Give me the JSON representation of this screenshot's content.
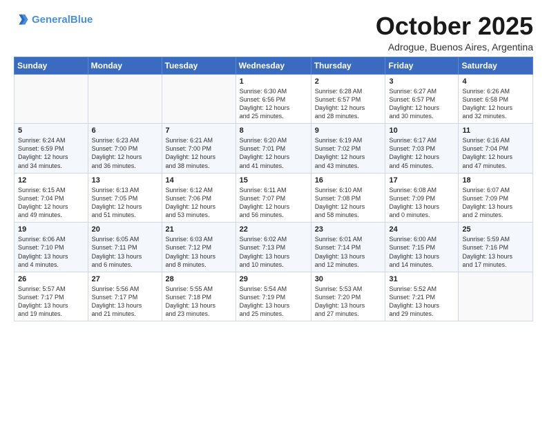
{
  "header": {
    "logo_line1": "General",
    "logo_line2": "Blue",
    "month": "October 2025",
    "location": "Adrogue, Buenos Aires, Argentina"
  },
  "weekdays": [
    "Sunday",
    "Monday",
    "Tuesday",
    "Wednesday",
    "Thursday",
    "Friday",
    "Saturday"
  ],
  "weeks": [
    [
      {
        "day": "",
        "content": ""
      },
      {
        "day": "",
        "content": ""
      },
      {
        "day": "",
        "content": ""
      },
      {
        "day": "1",
        "content": "Sunrise: 6:30 AM\nSunset: 6:56 PM\nDaylight: 12 hours\nand 25 minutes."
      },
      {
        "day": "2",
        "content": "Sunrise: 6:28 AM\nSunset: 6:57 PM\nDaylight: 12 hours\nand 28 minutes."
      },
      {
        "day": "3",
        "content": "Sunrise: 6:27 AM\nSunset: 6:57 PM\nDaylight: 12 hours\nand 30 minutes."
      },
      {
        "day": "4",
        "content": "Sunrise: 6:26 AM\nSunset: 6:58 PM\nDaylight: 12 hours\nand 32 minutes."
      }
    ],
    [
      {
        "day": "5",
        "content": "Sunrise: 6:24 AM\nSunset: 6:59 PM\nDaylight: 12 hours\nand 34 minutes."
      },
      {
        "day": "6",
        "content": "Sunrise: 6:23 AM\nSunset: 7:00 PM\nDaylight: 12 hours\nand 36 minutes."
      },
      {
        "day": "7",
        "content": "Sunrise: 6:21 AM\nSunset: 7:00 PM\nDaylight: 12 hours\nand 38 minutes."
      },
      {
        "day": "8",
        "content": "Sunrise: 6:20 AM\nSunset: 7:01 PM\nDaylight: 12 hours\nand 41 minutes."
      },
      {
        "day": "9",
        "content": "Sunrise: 6:19 AM\nSunset: 7:02 PM\nDaylight: 12 hours\nand 43 minutes."
      },
      {
        "day": "10",
        "content": "Sunrise: 6:17 AM\nSunset: 7:03 PM\nDaylight: 12 hours\nand 45 minutes."
      },
      {
        "day": "11",
        "content": "Sunrise: 6:16 AM\nSunset: 7:04 PM\nDaylight: 12 hours\nand 47 minutes."
      }
    ],
    [
      {
        "day": "12",
        "content": "Sunrise: 6:15 AM\nSunset: 7:04 PM\nDaylight: 12 hours\nand 49 minutes."
      },
      {
        "day": "13",
        "content": "Sunrise: 6:13 AM\nSunset: 7:05 PM\nDaylight: 12 hours\nand 51 minutes."
      },
      {
        "day": "14",
        "content": "Sunrise: 6:12 AM\nSunset: 7:06 PM\nDaylight: 12 hours\nand 53 minutes."
      },
      {
        "day": "15",
        "content": "Sunrise: 6:11 AM\nSunset: 7:07 PM\nDaylight: 12 hours\nand 56 minutes."
      },
      {
        "day": "16",
        "content": "Sunrise: 6:10 AM\nSunset: 7:08 PM\nDaylight: 12 hours\nand 58 minutes."
      },
      {
        "day": "17",
        "content": "Sunrise: 6:08 AM\nSunset: 7:09 PM\nDaylight: 13 hours\nand 0 minutes."
      },
      {
        "day": "18",
        "content": "Sunrise: 6:07 AM\nSunset: 7:09 PM\nDaylight: 13 hours\nand 2 minutes."
      }
    ],
    [
      {
        "day": "19",
        "content": "Sunrise: 6:06 AM\nSunset: 7:10 PM\nDaylight: 13 hours\nand 4 minutes."
      },
      {
        "day": "20",
        "content": "Sunrise: 6:05 AM\nSunset: 7:11 PM\nDaylight: 13 hours\nand 6 minutes."
      },
      {
        "day": "21",
        "content": "Sunrise: 6:03 AM\nSunset: 7:12 PM\nDaylight: 13 hours\nand 8 minutes."
      },
      {
        "day": "22",
        "content": "Sunrise: 6:02 AM\nSunset: 7:13 PM\nDaylight: 13 hours\nand 10 minutes."
      },
      {
        "day": "23",
        "content": "Sunrise: 6:01 AM\nSunset: 7:14 PM\nDaylight: 13 hours\nand 12 minutes."
      },
      {
        "day": "24",
        "content": "Sunrise: 6:00 AM\nSunset: 7:15 PM\nDaylight: 13 hours\nand 14 minutes."
      },
      {
        "day": "25",
        "content": "Sunrise: 5:59 AM\nSunset: 7:16 PM\nDaylight: 13 hours\nand 17 minutes."
      }
    ],
    [
      {
        "day": "26",
        "content": "Sunrise: 5:57 AM\nSunset: 7:17 PM\nDaylight: 13 hours\nand 19 minutes."
      },
      {
        "day": "27",
        "content": "Sunrise: 5:56 AM\nSunset: 7:17 PM\nDaylight: 13 hours\nand 21 minutes."
      },
      {
        "day": "28",
        "content": "Sunrise: 5:55 AM\nSunset: 7:18 PM\nDaylight: 13 hours\nand 23 minutes."
      },
      {
        "day": "29",
        "content": "Sunrise: 5:54 AM\nSunset: 7:19 PM\nDaylight: 13 hours\nand 25 minutes."
      },
      {
        "day": "30",
        "content": "Sunrise: 5:53 AM\nSunset: 7:20 PM\nDaylight: 13 hours\nand 27 minutes."
      },
      {
        "day": "31",
        "content": "Sunrise: 5:52 AM\nSunset: 7:21 PM\nDaylight: 13 hours\nand 29 minutes."
      },
      {
        "day": "",
        "content": ""
      }
    ]
  ]
}
